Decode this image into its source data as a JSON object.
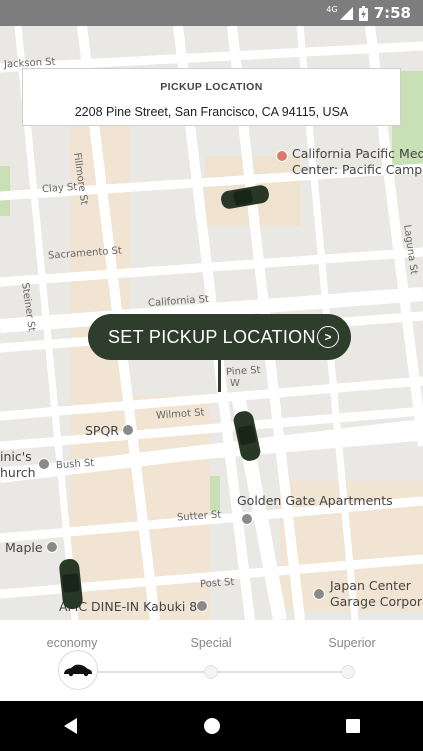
{
  "status_bar": {
    "network": "4G",
    "time": "7:58"
  },
  "pickup_card": {
    "title": "PICKUP LOCATION",
    "address": "2208 Pine Street, San Francisco, CA 94115, USA"
  },
  "pickup_button": {
    "label": "SET PICKUP LOCATION",
    "icon": "chevron-right-icon"
  },
  "map": {
    "streets": {
      "jackson": "Jackson St",
      "clay": "Clay St",
      "sacramento": "Sacramento St",
      "california": "California St",
      "pine": "Pine St",
      "wilmot": "Wilmot St",
      "bush": "Bush St",
      "sutter": "Sutter St",
      "post": "Post St",
      "fillmore": "Fillmore St",
      "steiner": "Steiner St",
      "laguna": "Laguna St",
      "webster": "W"
    },
    "pois": {
      "hospital_line1": "California Pacific Med",
      "hospital_line2": "Center: Pacific Campu",
      "spqr": "SPQR",
      "dominics_line1": "inic's",
      "dominics_line2": "hurch",
      "golden_gate": "Golden Gate Apartments",
      "maple": "Maple",
      "japan_line1": "Japan Center",
      "japan_line2": "Garage Corporat",
      "amc": "AMC DINE-IN Kabuki 8"
    },
    "cars": [
      "car-icon",
      "car-icon",
      "car-icon"
    ]
  },
  "service_tiers": {
    "items": [
      {
        "label": "economy",
        "position": 0.0
      },
      {
        "label": "Special",
        "position": 0.5
      },
      {
        "label": "Superior",
        "position": 1.0
      }
    ],
    "selected_index": 0
  },
  "nav_bar": {
    "icons": [
      "back-icon",
      "home-icon",
      "recents-icon"
    ]
  },
  "colors": {
    "accent": "#2f3d2d",
    "map_background": "#e9e8e4",
    "road": "#ffffff",
    "park": "#c9dfb6",
    "hospital_area": "#efe3d0"
  }
}
